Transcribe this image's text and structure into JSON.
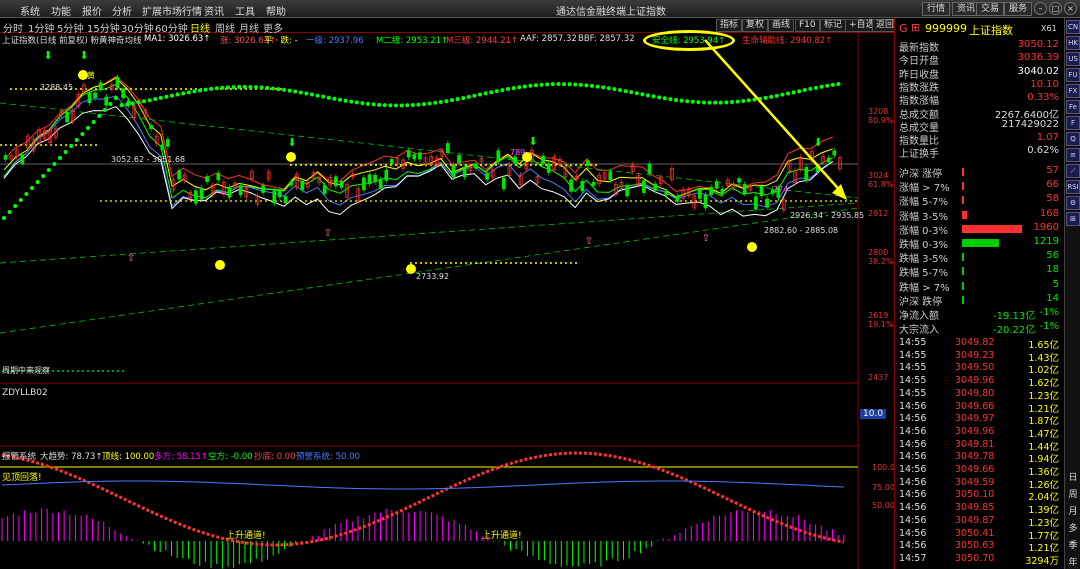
{
  "menubar": {
    "items": [
      "系统",
      "功能",
      "报价",
      "分析",
      "扩展市场行情",
      "资讯",
      "工具",
      "帮助"
    ],
    "title": "通达信金融终端",
    "subtitle": "上证指数",
    "right_buttons": [
      "行情",
      "资讯",
      "交易",
      "服务"
    ]
  },
  "periods": [
    "分时",
    "1分钟",
    "5分钟",
    "15分钟",
    "30分钟",
    "60分钟",
    "日线",
    "周线",
    "月线",
    "更多"
  ],
  "toolbar": [
    "指标",
    "复权",
    "画线",
    "F10",
    "标记",
    "+自选",
    "返回"
  ],
  "legend": {
    "name": "上证指数(日线 前复权) 粉黄神奇均线",
    "ma1": "MA1: 3026.63↑",
    "ma2": "涨: 3026.63↑",
    "ma3": "平 · 跌: -",
    "ma4": "一级: 2937.96",
    "ma5": "M二级: 2953.21↑",
    "ma6": "M三级: 2944.21↑",
    "aaf": "AAF: 2857.32",
    "bbf": "BBF: 2857.32",
    "safe": "安全线: 2953.94↑",
    "life": "生命辅助线: 2940.82↑"
  },
  "chart_labels": {
    "high": "3288.45",
    "mid": "3052.62 - 3051.68",
    "low": "2733.92",
    "r1": "2926.34 - 2935.85",
    "r2": "2882.60 - 2885.08",
    "tag": "黄",
    "v": "789",
    "v2": "774",
    "trace": "周期中来观察"
  },
  "yaxis": [
    {
      "v": "3208",
      "p": "80.9%"
    },
    {
      "v": "3024",
      "p": "61.8%"
    },
    {
      "v": "2912",
      "p": ""
    },
    {
      "v": "2800",
      "p": "38.2%"
    },
    {
      "v": "2619",
      "p": "19.1%"
    },
    {
      "v": "2437",
      "p": ""
    }
  ],
  "sub1": {
    "name": "ZDYLLB02",
    "value": "10.0"
  },
  "sub2": {
    "name": "报警系统",
    "trend": "大趋势: 78.73↑",
    "top": "顶线: 100.00",
    "bull": "多方: 58.15↑",
    "bear": "空方: -0.00",
    "selldip": "抄底: 0.00",
    "warn": "预警系统: 50.00",
    "jianding": "见顶回落!",
    "up1": "上升通道!",
    "up2": "上升通道!",
    "levels": [
      "100.0",
      "75.00",
      "50.00"
    ]
  },
  "quote": {
    "code": "999999",
    "name": "上证指数",
    "tag": "G",
    "code2": "X61",
    "rows": [
      [
        "最新指数",
        "3050.12"
      ],
      [
        "今日开盘",
        "3036.39"
      ],
      [
        "昨日收盘",
        "3040.02"
      ],
      [
        "指数涨跌",
        "10.10"
      ],
      [
        "指数涨幅",
        "0.33%"
      ],
      [
        "总成交额",
        "2267.6400亿"
      ],
      [
        "总成交量",
        "217429022"
      ],
      [
        "指数量比",
        "1.07"
      ],
      [
        "上证换手",
        "0.62%"
      ]
    ],
    "dist": [
      [
        "沪深 涨停",
        "57"
      ],
      [
        "涨幅 > 7%",
        "66"
      ],
      [
        "涨幅 5-7%",
        "58"
      ],
      [
        "涨幅 3-5%",
        "168"
      ],
      [
        "涨幅 0-3%",
        "1960"
      ],
      [
        "跌幅 0-3%",
        "1219"
      ],
      [
        "跌幅 3-5%",
        "56"
      ],
      [
        "跌幅 5-7%",
        "18"
      ],
      [
        "跌幅 > 7%",
        "5"
      ],
      [
        "沪深 跌停",
        "14"
      ]
    ],
    "flow": [
      [
        "净流入额",
        "-19.13亿",
        "-1%"
      ],
      [
        "大宗流入",
        "-20.22亿",
        "-1%"
      ]
    ],
    "ticks": [
      [
        "14:55",
        "3049.82",
        "1.65亿"
      ],
      [
        "14:55",
        "3049.23",
        "1.43亿"
      ],
      [
        "14:55",
        "3049.50",
        "1.02亿"
      ],
      [
        "14:55",
        "3049.96",
        "1.62亿"
      ],
      [
        "14:55",
        "3049.80",
        "1.23亿"
      ],
      [
        "14:56",
        "3049.66",
        "1.21亿"
      ],
      [
        "14:56",
        "3049.97",
        "1.87亿"
      ],
      [
        "14:56",
        "3049.96",
        "1.47亿"
      ],
      [
        "14:56",
        "3049.81",
        "1.44亿"
      ],
      [
        "14:56",
        "3049.78",
        "1.94亿"
      ],
      [
        "14:56",
        "3049.66",
        "1.36亿"
      ],
      [
        "14:56",
        "3049.59",
        "1.26亿"
      ],
      [
        "14:56",
        "3050.10",
        "2.04亿"
      ],
      [
        "14:56",
        "3049.85",
        "1.39亿"
      ],
      [
        "14:56",
        "3049.87",
        "1.23亿"
      ],
      [
        "14:56",
        "3050.41",
        "1.77亿"
      ],
      [
        "14:56",
        "3050.63",
        "1.21亿"
      ],
      [
        "14:57",
        "3050.70",
        "3294万"
      ]
    ]
  },
  "sidetabs": [
    "CN",
    "HK",
    "US",
    "FU",
    "FX",
    "Fe",
    "F",
    "Q",
    "≡",
    "⟋",
    "RSI",
    "⚙",
    "⊞",
    "日",
    "周",
    "月",
    "多",
    "季",
    "年"
  ],
  "colors": {
    "up": "#ff3232",
    "down": "#00e600",
    "gold": "#ffff00",
    "magenta": "#ff00ff",
    "green": "#00ff00",
    "cyan": "#00d0d0"
  }
}
